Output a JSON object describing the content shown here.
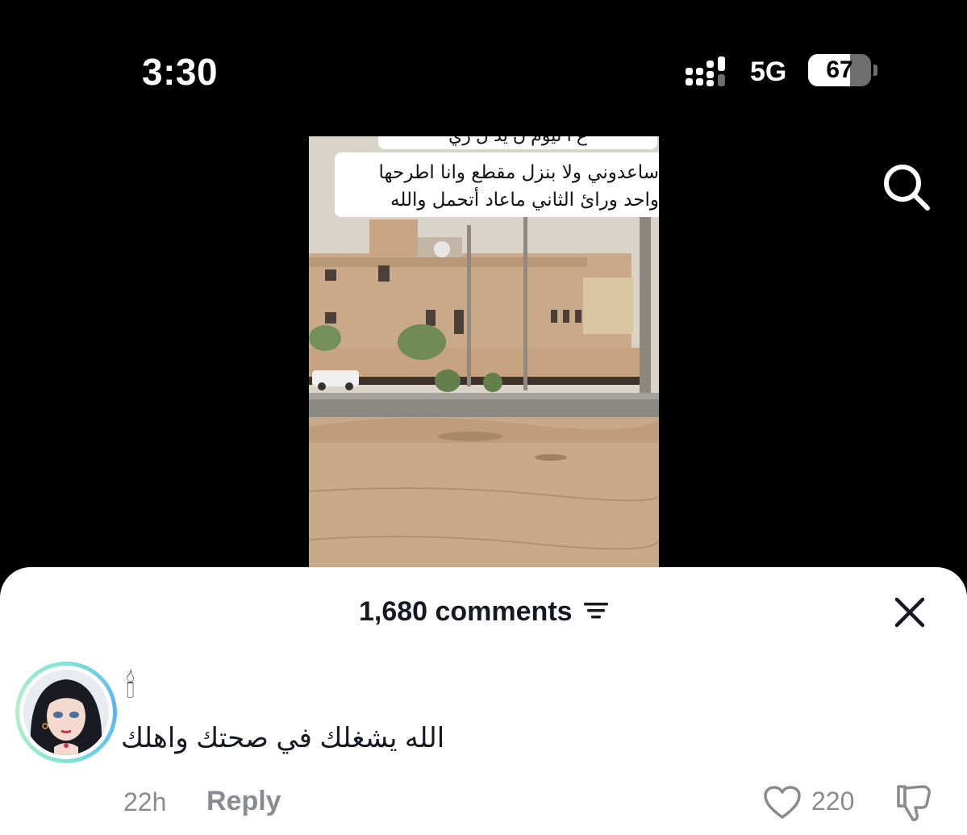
{
  "status_bar": {
    "time": "3:30",
    "network": "5G",
    "battery": "67",
    "battery_level": 0.67
  },
  "top_icons": {
    "search": "search-icon"
  },
  "video": {
    "caption_partial": "ع ا ليوم ن يد ل ري",
    "caption_line1": "ساعدوني ولا بنزل مقطع وانا اطرحها",
    "caption_line2": "واحد ورائ الثاني ماعاد أتحمل والله"
  },
  "comments_sheet": {
    "title": "1,680 comments",
    "sort_icon": "sort-icon",
    "close_icon": "close-icon"
  },
  "comment": {
    "username": "🕯",
    "text": "الله يشغلك في صحتك واهلك",
    "time": "22h",
    "reply_label": "Reply",
    "like_count": "220",
    "like_icon": "heart-icon",
    "dislike_icon": "thumbs-down-icon"
  },
  "colors": {
    "ring_accent": "#5ab4f0",
    "secondary_text": "#8a8b91",
    "primary_text": "#161823"
  }
}
